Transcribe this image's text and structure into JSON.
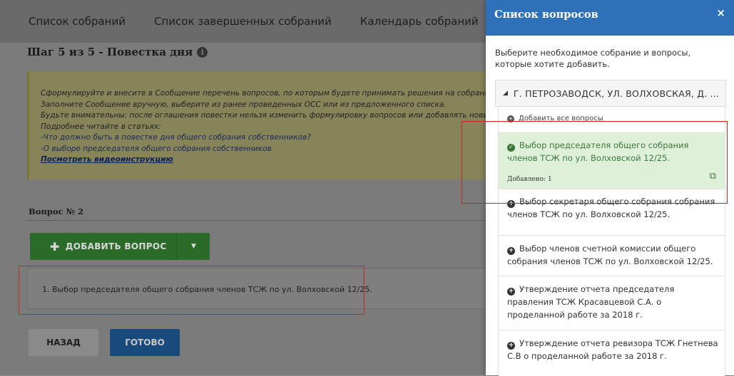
{
  "nav": {
    "items": [
      "Список собраний",
      "Список завершенных собраний",
      "Календарь собраний"
    ]
  },
  "step_title": "Шаг 5 из 5 - Повестка дня",
  "hint": {
    "lines": [
      "Сформулируйте и внесите в Сообщение перечень вопросов, по которым будете принимать решения на собрании",
      "Заполните Сообщение вручную, выберите из ранее проведенных ОСС или из предложенного списка.",
      "Будьте внимательны: после оглашения повестки нельзя изменить формулировку вопросов или добавлять новые",
      "Подробнее читайте в статьях:"
    ],
    "links": [
      "-Что должно быть в повестке дня общего собрания собственников?",
      "-О выборе председателя общего собрания собственников"
    ],
    "video_link": "Посмотреть видеоинструкцию"
  },
  "question_label": "Вопрос № 2",
  "add_button": {
    "label": "ДОБАВИТЬ ВОПРОС"
  },
  "added_question": "1. Выбор председателя общего собрания членов ТСЖ по ул. Волховской 12/25.",
  "buttons": {
    "back": "НАЗАД",
    "done": "ГОТОВО"
  },
  "panel": {
    "title": "Список вопросов",
    "close": "×",
    "description": "Выберите необходимое собрание и вопросы, которые хотите добавить.",
    "meeting_title": "Г. ПЕТРОЗАВОДСК, УЛ. ВОЛХОВСКАЯ, Д. ...",
    "add_all": "Добавить все вопросы",
    "items": [
      {
        "text": "Выбор председателя общего собрания членов ТСЖ по ул. Волховской 12/25.",
        "added": "Добавлено: 1"
      },
      {
        "text": "Выбор секретаря общего собрания собрания членов ТСЖ по ул. Волховской 12/25."
      },
      {
        "text": "Выбор членов счетной комиссии общего собрания членов ТСЖ по ул. Волховской 12/25."
      },
      {
        "text": "Утверждение отчета председателя правления ТСЖ Красавцевой С.А. о проделанной работе за 2018 г."
      },
      {
        "text": "Утверждение отчета ревизора ТСЖ Гнетнева С.В о проделанной работе за 2018 г."
      }
    ]
  },
  "colors": {
    "panel_header": "#2e71b9",
    "add_button": "#2a6b2a",
    "done_button": "#184a7c",
    "selected_item": "#dff0d8",
    "highlight_frame": "#d32020"
  }
}
